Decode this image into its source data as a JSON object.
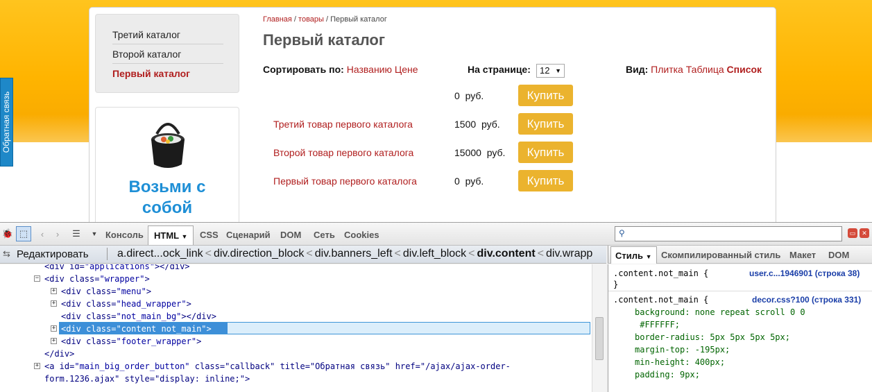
{
  "feedback_tab": "Обратная связь",
  "menu": {
    "items": [
      {
        "label": "Третий каталог",
        "active": false
      },
      {
        "label": "Второй каталог",
        "active": false
      },
      {
        "label": "Первый каталог",
        "active": true
      }
    ]
  },
  "banner": {
    "title_line1": "Возьми с",
    "title_line2": "собой"
  },
  "breadcrumb": {
    "home": "Главная",
    "sep1": " / ",
    "goods": "товары",
    "sep2": " / ",
    "current": "Первый каталог"
  },
  "page_title": "Первый каталог",
  "sort": {
    "label": "Сортировать по:",
    "by_name": "Названию",
    "by_price": "Цене"
  },
  "per_page": {
    "label": "На странице:",
    "value": "12"
  },
  "view": {
    "label": "Вид:",
    "tile": "Плитка",
    "table": "Таблица",
    "list": "Список"
  },
  "products": [
    {
      "name": "",
      "price": "0",
      "currency": "руб.",
      "buy": "Купить"
    },
    {
      "name": "Третий товар первого каталога",
      "price": "1500",
      "currency": "руб.",
      "buy": "Купить"
    },
    {
      "name": "Второй товар первого каталога",
      "price": "15000",
      "currency": "руб.",
      "buy": "Купить"
    },
    {
      "name": "Первый товар первого каталога",
      "price": "0",
      "currency": "руб.",
      "buy": "Купить"
    }
  ],
  "devtools": {
    "tabs": [
      "Консоль",
      "HTML",
      "CSS",
      "Сценарий",
      "DOM",
      "Сеть",
      "Cookies"
    ],
    "active_tab": "HTML",
    "edit_button": "Редактировать",
    "path": [
      "a.direct...ock_link",
      "div.direction_block",
      "div.banners_left",
      "div.left_block",
      "div.content",
      "div.wrapp"
    ],
    "path_current": "div.content",
    "html_lines": [
      {
        "a": "<div id=",
        "b": "\"applications\"",
        "c": "></div>"
      },
      {
        "a": "<div class=",
        "b": "\"wrapper\"",
        "c": ">"
      },
      {
        "a": "<div class=",
        "b": "\"menu\"",
        "c": ">"
      },
      {
        "a": "<div class=",
        "b": "\"head_wrapper\"",
        "c": ">"
      },
      {
        "a": "<div class=",
        "b": "\"not_main_bg\"",
        "c": "></div>"
      },
      {
        "a": "<div class=",
        "b": "\"content not_main\"",
        "c": ">"
      },
      {
        "a": "<div class=",
        "b": "\"footer_wrapper\"",
        "c": ">"
      },
      {
        "a": "</div>",
        "b": "",
        "c": ""
      },
      {
        "a": "<a id=",
        "b": "\"main_big_order_button\"",
        "c": " class=\"callback\" title=\"Обратная связь\" href=\"/ajax/ajax-order-"
      },
      {
        "a": "form.1236.ajax\" style=\"display: inline;\">",
        "b": "",
        "c": ""
      }
    ],
    "style_tabs": [
      "Стиль",
      "Скомпилированный стиль",
      "Макет",
      "DOM"
    ],
    "active_style_tab": "Стиль",
    "rule1": {
      "selector": ".content.not_main {",
      "source": "user.c...1946901 (строка 38)",
      "close": "}"
    },
    "rule2": {
      "selector": ".content.not_main {",
      "source": "decor.css?100 (строка 331)",
      "props": [
        "background: none repeat scroll 0 0",
        " #FFFFFF;",
        "border-radius: 5px 5px 5px 5px;",
        "margin-top: -195px;",
        "min-height: 400px;",
        "padding: 9px;"
      ]
    }
  }
}
